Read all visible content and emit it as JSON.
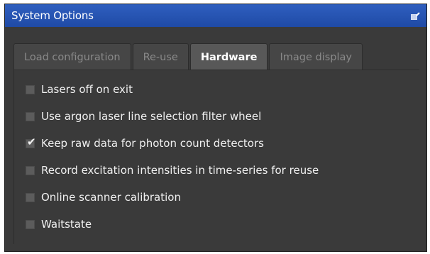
{
  "window": {
    "title": "System Options",
    "undock_icon": "undock-icon"
  },
  "tabs": [
    {
      "label": "Load configuration",
      "active": false
    },
    {
      "label": "Re-use",
      "active": false
    },
    {
      "label": "Hardware",
      "active": true
    },
    {
      "label": "Image display",
      "active": false
    }
  ],
  "options": [
    {
      "label": "Lasers off on exit",
      "checked": false
    },
    {
      "label": "Use argon laser line selection filter wheel",
      "checked": false
    },
    {
      "label": "Keep raw data for photon count detectors",
      "checked": true
    },
    {
      "label": "Record excitation intensities in time-series for reuse",
      "checked": false
    },
    {
      "label": "Online scanner calibration",
      "checked": false
    },
    {
      "label": "Waitstate",
      "checked": false
    }
  ],
  "colors": {
    "titlebar": "#2a57b5",
    "panel": "#3a3a3a",
    "active_tab": "#585858"
  }
}
